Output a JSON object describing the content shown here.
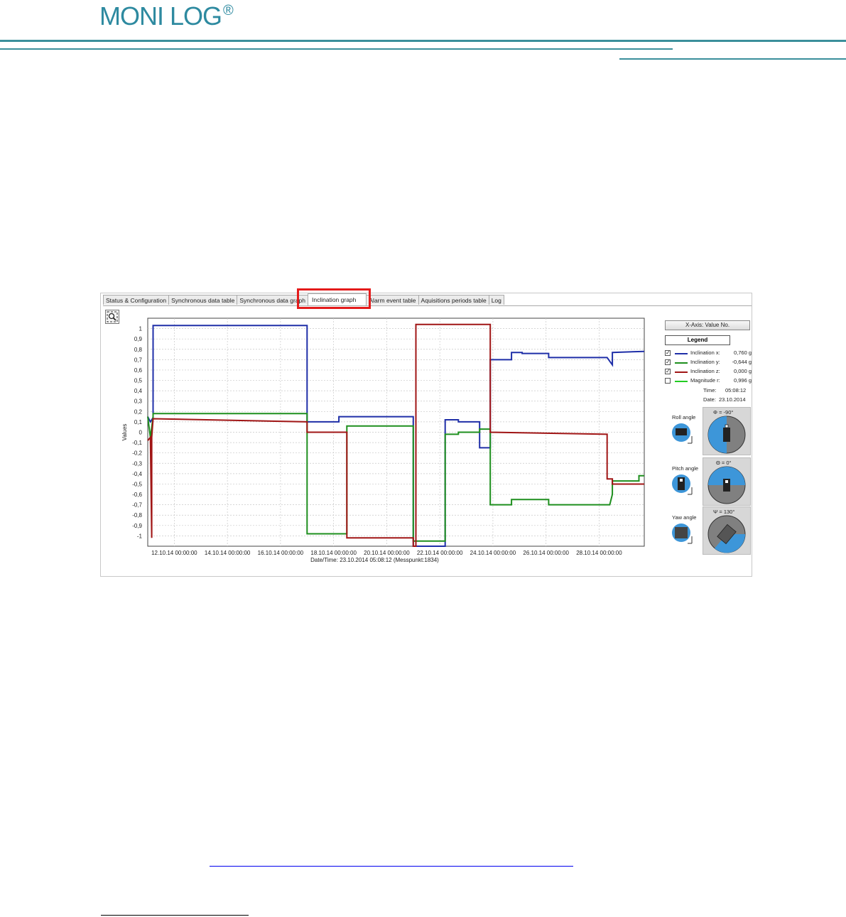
{
  "brand": {
    "logo_text": "MONI LOG",
    "logo_mark": "®"
  },
  "tabs": [
    "Status & Configuration",
    "Synchronous data table",
    "Synchronous data graph",
    "Inclination graph",
    "Alarm event table",
    "Aquisitions periods table",
    "Log"
  ],
  "active_tab": "Inclination graph",
  "toolbar": {
    "zoom_icon": "zoom-icon"
  },
  "sidebar": {
    "xaxis_button": "X-Axis: Value No.",
    "legend_button": "Legend",
    "legend_items": [
      {
        "name": "Inclination x:",
        "value": "0,760 g",
        "checked": true,
        "check_mark": "✓",
        "color": "#1f2fa8"
      },
      {
        "name": "Inclination y:",
        "value": "-0,644 g",
        "checked": true,
        "check_mark": "✓",
        "color": "#1e8f1e"
      },
      {
        "name": "Inclination z:",
        "value": "0,000 g",
        "checked": true,
        "check_mark": "✓",
        "color": "#a01515"
      },
      {
        "name": "Magnitude r:",
        "value": "0,996 g",
        "checked": false,
        "check_mark": "",
        "color": "#22cc22"
      }
    ],
    "time_label": "Time:",
    "time_value": "05:08:12",
    "date_label": "Date:",
    "date_value": "23.10.2014",
    "angles": [
      {
        "label": "Roll angle",
        "value": "Φ = -90°"
      },
      {
        "label": "Pitch angle",
        "value": "Θ = 0°"
      },
      {
        "label": "Yaw angle",
        "value": "Ψ = 130°"
      }
    ]
  },
  "chart_data": {
    "type": "line",
    "xlabel": "Date/Time: 23.10.2014 05:08:12   (Messpunkt:1834)",
    "ylabel": "Values",
    "ylim": [
      -1.1,
      1.1
    ],
    "y_ticks": [
      "1",
      "0,9",
      "0,8",
      "0,7",
      "0,6",
      "0,5",
      "0,4",
      "0,3",
      "0,2",
      "0,1",
      "0",
      "-0,1",
      "-0,2",
      "-0,3",
      "-0,4",
      "-0,5",
      "-0,6",
      "-0,7",
      "-0,8",
      "-0,9",
      "-1"
    ],
    "x_ticks": [
      "12.10.14 00:00:00",
      "14.10.14 00:00:00",
      "16.10.14 00:00:00",
      "18.10.14 00:00:00",
      "20.10.14 00:00:00",
      "22.10.14 00:00:00",
      "24.10.14 00:00:00",
      "26.10.14 00:00:00",
      "28.10.14 00:00:00"
    ],
    "xlim": [
      0,
      18.7
    ],
    "grid": true,
    "series": [
      {
        "name": "Inclination x",
        "color": "#1f2fa8",
        "x": [
          0,
          0.1,
          0.2,
          0.2,
          6.0,
          6.0,
          7.2,
          7.2,
          10.0,
          10.0,
          11.2,
          11.2,
          11.7,
          11.7,
          12.5,
          12.5,
          12.9,
          12.9,
          13.7,
          13.7,
          14.1,
          14.1,
          15.1,
          15.1,
          17.3,
          17.5,
          17.5,
          18.7
        ],
        "y": [
          0.15,
          0.1,
          0.14,
          1.03,
          1.03,
          0.1,
          0.1,
          0.15,
          0.15,
          -1.1,
          -1.1,
          0.12,
          0.12,
          0.1,
          0.1,
          -0.15,
          -0.15,
          0.7,
          0.7,
          0.77,
          0.77,
          0.76,
          0.76,
          0.72,
          0.72,
          0.65,
          0.77,
          0.78
        ]
      },
      {
        "name": "Inclination y",
        "color": "#1e8f1e",
        "x": [
          0,
          0.1,
          0.2,
          0.2,
          6.0,
          6.0,
          7.5,
          7.5,
          10.0,
          10.0,
          11.2,
          11.2,
          11.7,
          11.7,
          12.5,
          12.5,
          12.9,
          12.9,
          13.7,
          13.7,
          14.1,
          14.1,
          15.1,
          15.1,
          17.4,
          17.5,
          17.5,
          18.5,
          18.5,
          18.7
        ],
        "y": [
          0.15,
          -0.05,
          0.15,
          0.18,
          0.18,
          -0.98,
          -0.98,
          0.06,
          0.06,
          -1.05,
          -1.05,
          -0.02,
          -0.02,
          0.0,
          0.0,
          0.03,
          0.03,
          -0.7,
          -0.7,
          -0.65,
          -0.65,
          -0.65,
          -0.65,
          -0.7,
          -0.7,
          -0.6,
          -0.47,
          -0.47,
          -0.42,
          -0.42
        ]
      },
      {
        "name": "Inclination z",
        "color": "#a01515",
        "x": [
          0,
          0.1,
          0.15,
          0.15,
          0.2,
          0.2,
          6.0,
          6.0,
          7.5,
          7.5,
          10.0,
          10.0,
          10.1,
          10.1,
          12.9,
          12.9,
          17.3,
          17.3,
          17.5,
          17.5,
          18.7
        ],
        "y": [
          -0.08,
          -0.05,
          -1.02,
          -0.05,
          0.13,
          0.13,
          0.1,
          0.0,
          0.0,
          -1.02,
          -1.02,
          -1.1,
          -1.1,
          1.04,
          1.04,
          0.0,
          -0.02,
          -0.45,
          -0.45,
          -0.5,
          -0.5
        ]
      }
    ]
  }
}
